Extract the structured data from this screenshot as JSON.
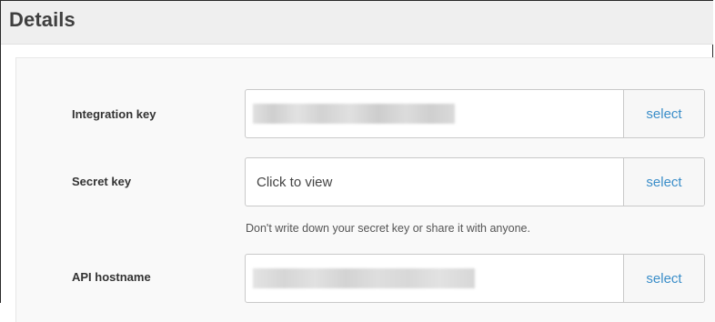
{
  "section": {
    "title": "Details"
  },
  "fields": [
    {
      "label": "Integration key",
      "value": "",
      "select_label": "select",
      "redacted": true
    },
    {
      "label": "Secret key",
      "value": "Click to view",
      "select_label": "select",
      "redacted": false
    },
    {
      "label": "API hostname",
      "value": "",
      "select_label": "select",
      "redacted": true
    }
  ],
  "secret_help": "Don't write down your secret key or share it with anyone.",
  "colors": {
    "link": "#3b8ec9",
    "header_bg": "#efefef",
    "panel_bg": "#f9f9f9",
    "border": "#c9c9c9",
    "redaction": "#d7d7d7"
  },
  "icons": {
    "redacted_block": "blurred-rectangle"
  }
}
